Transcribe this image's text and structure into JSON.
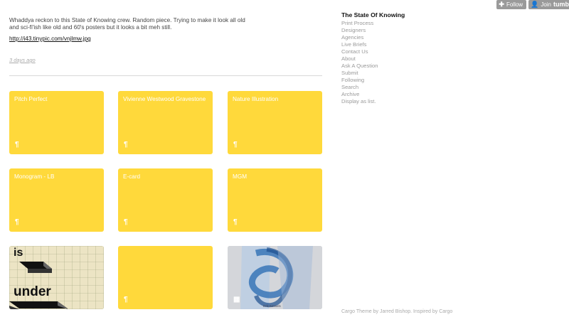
{
  "tumblr": {
    "follow_label": "Follow",
    "join_label": "Join",
    "join_brand": "tumb"
  },
  "post": {
    "body": "Whaddya reckon to this State of Knowing crew. Random piece. Trying to make it look all old and sci-fi'ish like old and 60's posters but it looks a bit meh still.",
    "link": "http://i43.tinypic.com/vnjlmw.jpg",
    "date": "3 days ago"
  },
  "tiles": [
    {
      "title": "Pitch Perfect",
      "icon": "paragraph-icon"
    },
    {
      "title": "Vivienne Westwood Gravestone",
      "icon": "paragraph-icon"
    },
    {
      "title": "Nature Illustration",
      "icon": "paragraph-icon"
    },
    {
      "title": "Monogram - LB",
      "icon": "paragraph-icon"
    },
    {
      "title": "E-card",
      "icon": "paragraph-icon"
    },
    {
      "title": "MGM",
      "icon": "paragraph-icon"
    },
    {
      "title": "",
      "icon": "image-thumbnail",
      "image_text_1": "is",
      "image_text_2": "under"
    },
    {
      "title": "",
      "icon": "paragraph-icon"
    },
    {
      "title": "",
      "icon": "grid-icon",
      "image_caption": "Erik Kessels"
    }
  ],
  "sidebar": {
    "site_title": "The State Of Knowing",
    "nav": [
      "Print Process",
      "Designers",
      "Agencies",
      "Live Briefs",
      "Contact Us",
      "About",
      "Ask A Question",
      "Submit",
      "Following",
      "Search",
      "Archive",
      "Display as list."
    ]
  },
  "footer": "Cargo Theme by Jarred Bishop. Inspired by Cargo",
  "colors": {
    "tile": "#ffd93b",
    "sidebar_nav": "#9a9a9a",
    "tumblr_button": "#9a9a9a"
  },
  "glyphs": {
    "plus": "✚",
    "person": "👤",
    "paragraph": "¶",
    "grid": "▦"
  }
}
